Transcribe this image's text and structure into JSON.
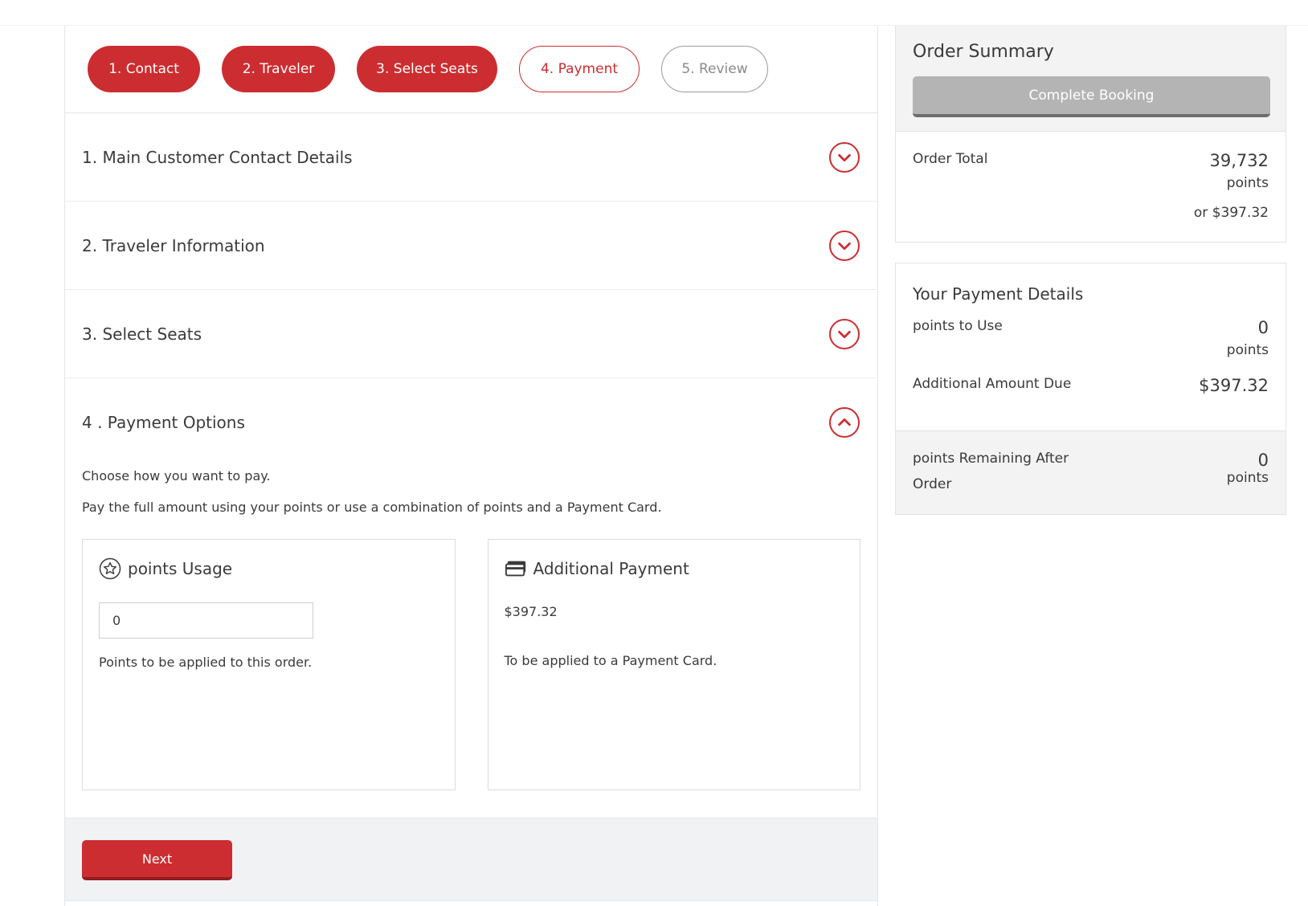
{
  "steps": [
    {
      "label": "1. Contact",
      "state": "done"
    },
    {
      "label": "2. Traveler",
      "state": "done"
    },
    {
      "label": "3. Select Seats",
      "state": "done"
    },
    {
      "label": "4. Payment",
      "state": "current"
    },
    {
      "label": "5. Review",
      "state": "todo"
    }
  ],
  "sections": {
    "contact": "1. Main Customer Contact Details",
    "traveler": "2. Traveler Information",
    "seats": "3. Select Seats",
    "payment": "4 . Payment Options"
  },
  "payment": {
    "intro1": "Choose how you want to pay.",
    "intro2": "Pay the full amount using your points or use a combination of points and a Payment Card.",
    "points_card": {
      "title": "points Usage",
      "icon": "star-circle-icon",
      "input_value": "0",
      "note": "Points to be applied to this order."
    },
    "additional_card": {
      "title": "Additional Payment",
      "icon": "credit-card-icon",
      "amount": "$397.32",
      "note": "To be applied to a Payment Card."
    },
    "next_label": "Next"
  },
  "summary": {
    "title": "Order Summary",
    "complete_label": "Complete Booking",
    "order_total_label": "Order Total",
    "order_total_value": "39,732",
    "order_total_unit": "points",
    "order_total_alt": "or $397.32"
  },
  "payment_details": {
    "title": "Your Payment Details",
    "points_to_use_label": "points to Use",
    "points_to_use_value": "0",
    "points_to_use_unit": "points",
    "additional_label": "Additional Amount Due",
    "additional_value": "$397.32",
    "remaining_label": "points Remaining After Order",
    "remaining_value": "0",
    "remaining_unit": "points"
  },
  "colors": {
    "brand_red": "#cc2d30",
    "disabled_gray": "#b4b4b4"
  }
}
